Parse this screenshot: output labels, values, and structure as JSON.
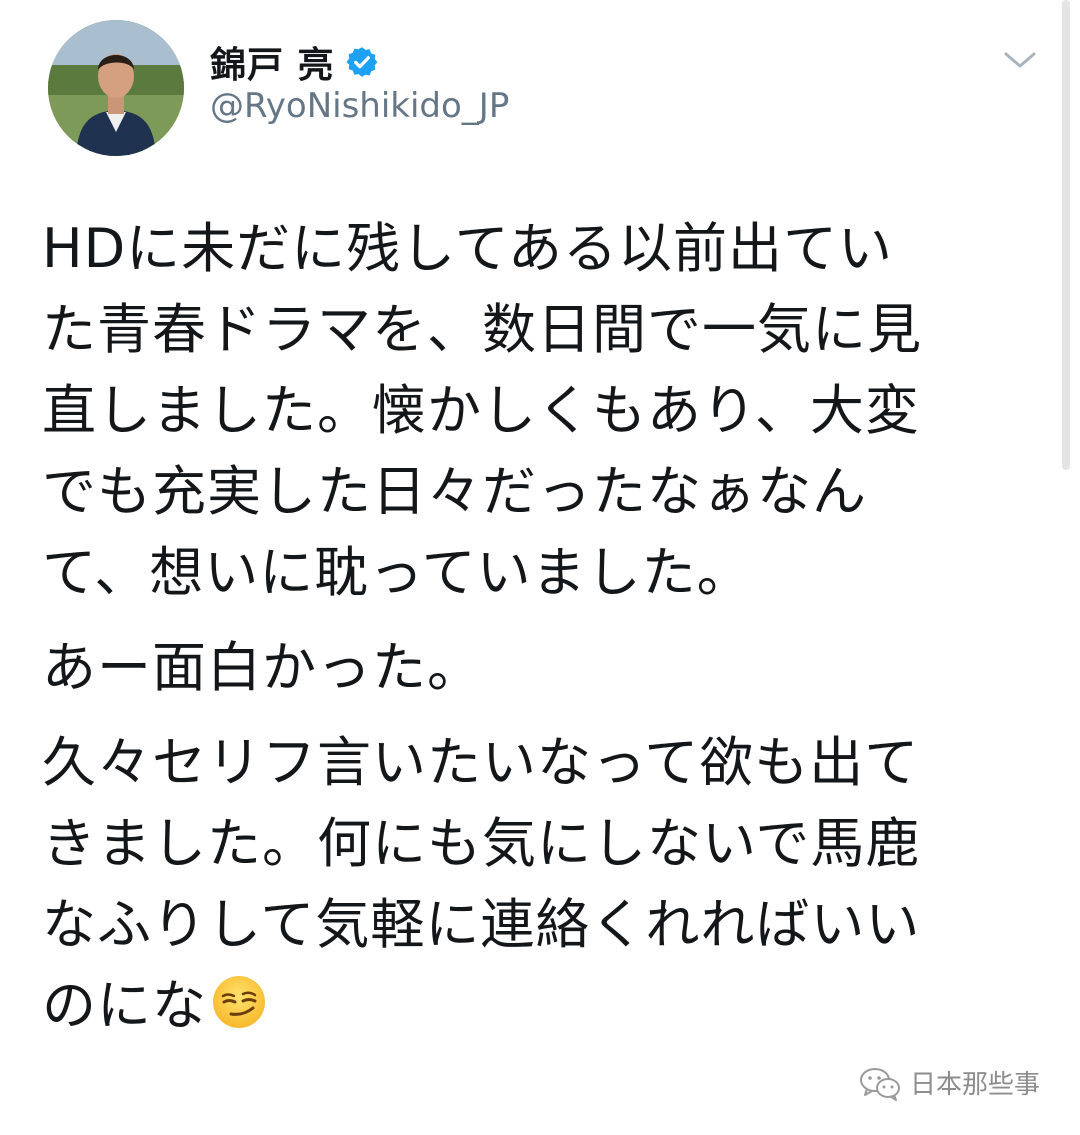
{
  "user": {
    "display_name": "錦戸 亮",
    "handle": "@RyoNishikido_JP",
    "verified": true,
    "avatar_icon": "profile-photo"
  },
  "menu": {
    "icon": "chevron-down-icon"
  },
  "tweet": {
    "paragraph1": [
      "HDに未だに残してある以前出てい",
      "た青春ドラマを、数日間で一気に見",
      "直しました。懐かしくもあり、大変",
      "でも充実した日々だったなぁなん",
      "て、想いに耽っていました。"
    ],
    "paragraph2": [
      "あー面白かった。"
    ],
    "paragraph3": [
      "久々セリフ言いたいなって欲も出て",
      "きました。何にも気にしないで馬鹿",
      "なふりして気軽に連絡くれればいい",
      "のにな"
    ],
    "emoji": "smirking-face"
  },
  "watermark": {
    "text": "日本那些事",
    "icon": "wechat-icon"
  },
  "colors": {
    "verified": "#1da1f2",
    "handle": "#657786",
    "text": "#14171a"
  }
}
